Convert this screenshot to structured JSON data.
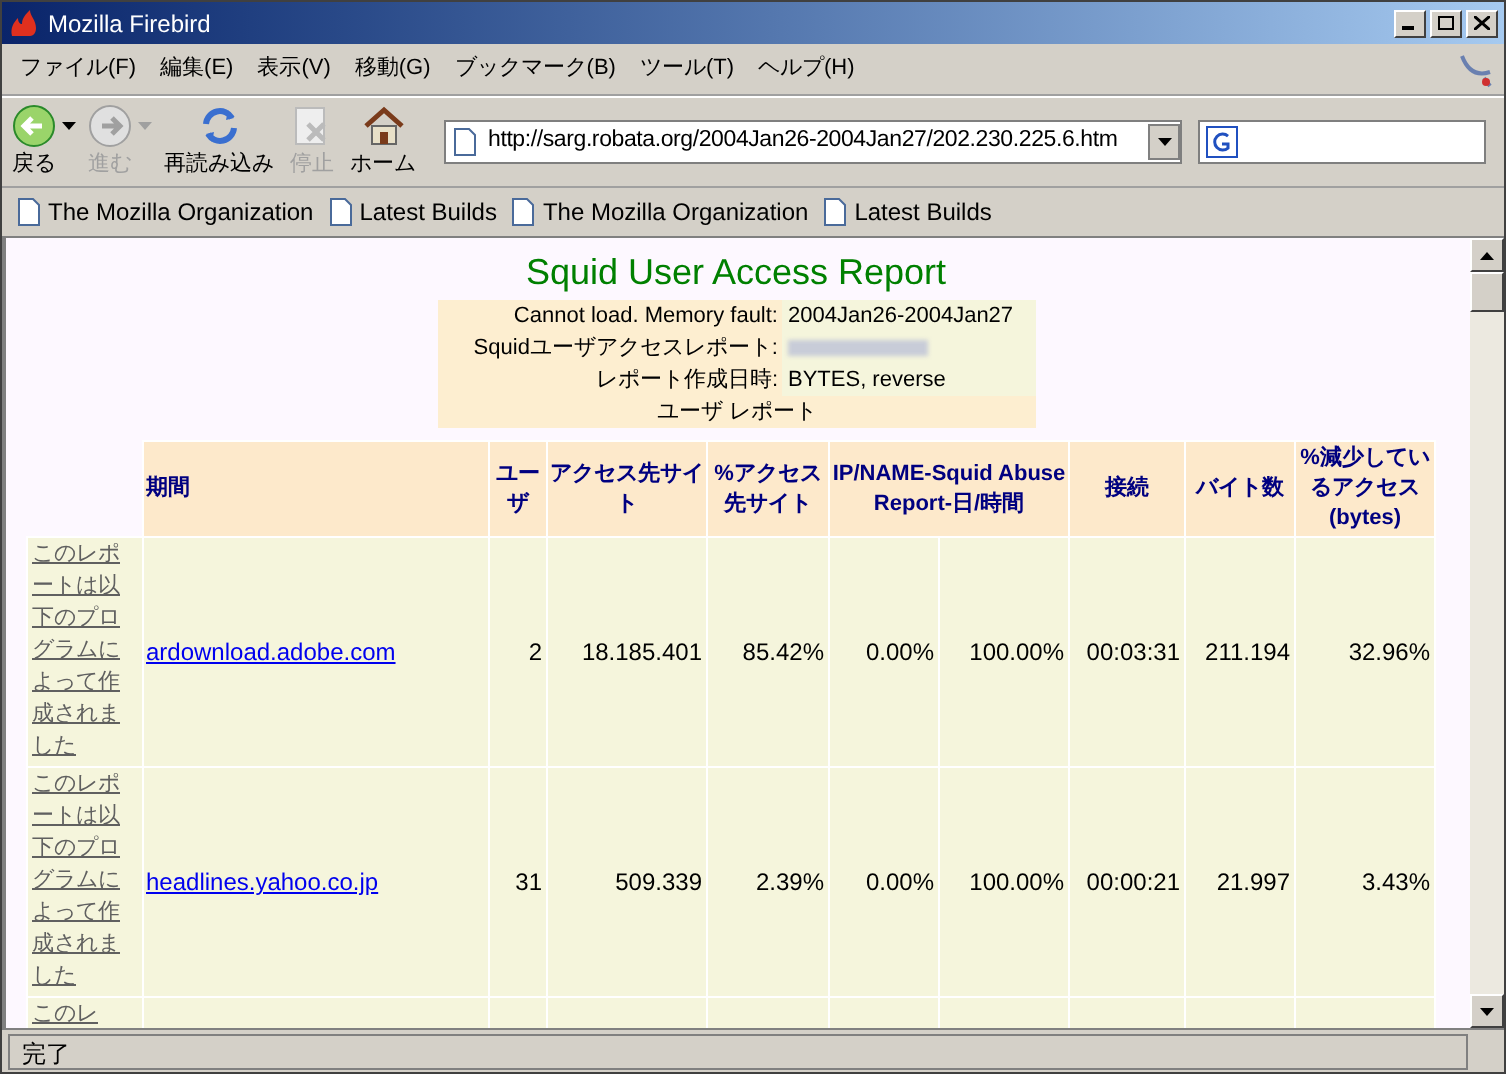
{
  "window": {
    "title": "Mozilla Firebird"
  },
  "menu": [
    "ファイル(F)",
    "編集(E)",
    "表示(V)",
    "移動(G)",
    "ブックマーク(B)",
    "ツール(T)",
    "ヘルプ(H)"
  ],
  "toolbar": [
    {
      "kind": "back",
      "label": "戻る",
      "disabled": false,
      "dropdown": true
    },
    {
      "kind": "forward",
      "label": "進む",
      "disabled": true,
      "dropdown": true
    },
    {
      "kind": "reload",
      "label": "再読み込み",
      "disabled": false,
      "dropdown": false
    },
    {
      "kind": "stop",
      "label": "停止",
      "disabled": true,
      "dropdown": false
    },
    {
      "kind": "home",
      "label": "ホーム",
      "disabled": false,
      "dropdown": false
    }
  ],
  "address": {
    "value": "http://sarg.robata.org/2004Jan26-2004Jan27/202.230.225.6.htm"
  },
  "bookmarks": [
    "The Mozilla Organization",
    "Latest Builds",
    "The Mozilla Organization",
    "Latest Builds"
  ],
  "report": {
    "title": "Squid User Access Report",
    "info": [
      {
        "label": "Cannot load. Memory fault:",
        "value": "2004Jan26-2004Jan27",
        "redacted": false
      },
      {
        "label": "Squidユーザアクセスレポート:",
        "redacted": true
      },
      {
        "label": "レポート作成日時:",
        "value": "BYTES, reverse",
        "redacted": false
      }
    ],
    "subtitle": "ユーザ レポート",
    "columns": [
      {
        "label": "期間"
      },
      {
        "label": "ユーザ"
      },
      {
        "label": "アクセス先サイト"
      },
      {
        "label": "%アクセス先サイト"
      },
      {
        "label": "IP/NAME-Squid Abuse Report-日/時間",
        "colspan": 2
      },
      {
        "label": "接続"
      },
      {
        "label": "バイト数"
      },
      {
        "label": "%減少しているアクセス (bytes)"
      }
    ],
    "rows": [
      {
        "link": "このレポートは以下のプログラムによって作成されました",
        "cells": [
          "ardownload.adobe.com",
          "2",
          "18.185.401",
          "85.42%",
          "0.00%",
          "100.00%",
          "00:03:31",
          "211.194",
          "32.96%"
        ]
      },
      {
        "link": "このレポートは以下のプログラムによって作成されました",
        "cells": [
          "headlines.yahoo.co.jp",
          "31",
          "509.339",
          "2.39%",
          "0.00%",
          "100.00%",
          "00:00:21",
          "21.997",
          "3.43%"
        ]
      },
      {
        "link": "このレ",
        "cells": []
      }
    ]
  },
  "status_bar": {
    "text": "完了"
  }
}
